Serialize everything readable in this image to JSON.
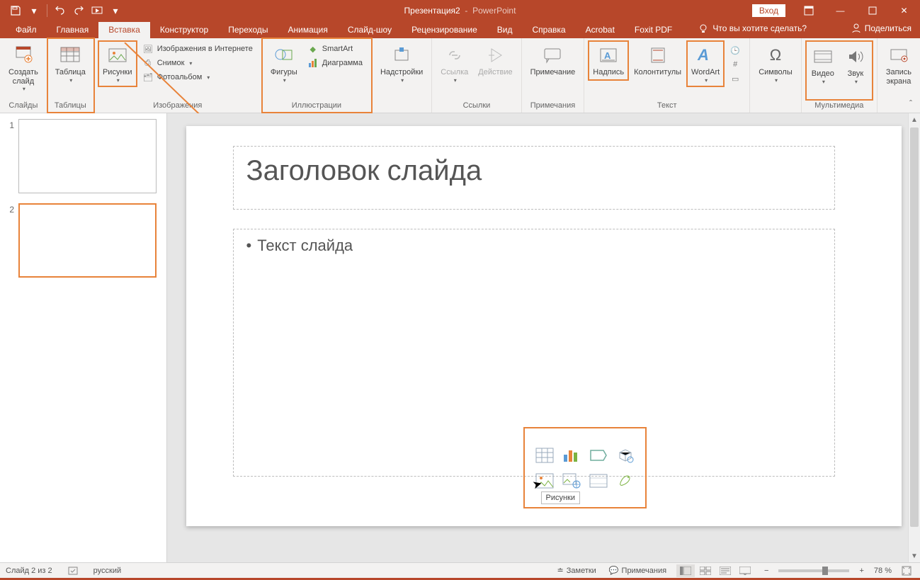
{
  "title": {
    "doc": "Презентация2",
    "app": "PowerPoint"
  },
  "signin": "Вход",
  "tabs": [
    "Файл",
    "Главная",
    "Вставка",
    "Конструктор",
    "Переходы",
    "Анимация",
    "Слайд-шоу",
    "Рецензирование",
    "Вид",
    "Справка",
    "Acrobat",
    "Foxit PDF"
  ],
  "active_tab": 2,
  "tell_me": "Что вы хотите сделать?",
  "share": "Поделиться",
  "ribbon": {
    "groups": {
      "slides": {
        "label": "Слайды",
        "new_slide": "Создать\nслайд"
      },
      "tables": {
        "label": "Таблицы",
        "table": "Таблица"
      },
      "images": {
        "label": "Изображения",
        "pictures": "Рисунки",
        "online": "Изображения в Интернете",
        "screenshot": "Снимок",
        "album": "Фотоальбом"
      },
      "illustrations": {
        "label": "Иллюстрации",
        "shapes": "Фигуры",
        "smartart": "SmartArt",
        "chart": "Диаграмма"
      },
      "addins": {
        "label": "",
        "addins_btn": "Надстройки"
      },
      "links": {
        "label": "Ссылки",
        "link": "Ссылка",
        "action": "Действие"
      },
      "comments": {
        "label": "Примечания",
        "comment": "Примечание"
      },
      "text": {
        "label": "Текст",
        "textbox": "Надпись",
        "headerfooter": "Колонтитулы",
        "wordart": "WordArt"
      },
      "symbols": {
        "label": "",
        "symbols_btn": "Символы"
      },
      "media": {
        "label": "Мультимедиа",
        "video": "Видео",
        "audio": "Звук",
        "screenrec": "Запись\nэкрана"
      }
    }
  },
  "thumbs": {
    "count": 2,
    "selected": 2
  },
  "slide": {
    "title_placeholder": "Заголовок слайда",
    "body_placeholder": "Текст слайда"
  },
  "tooltip": "Рисунки",
  "status": {
    "slide_info": "Слайд 2 из 2",
    "language": "русский",
    "notes": "Заметки",
    "comments": "Примечания",
    "zoom": "78 %"
  }
}
